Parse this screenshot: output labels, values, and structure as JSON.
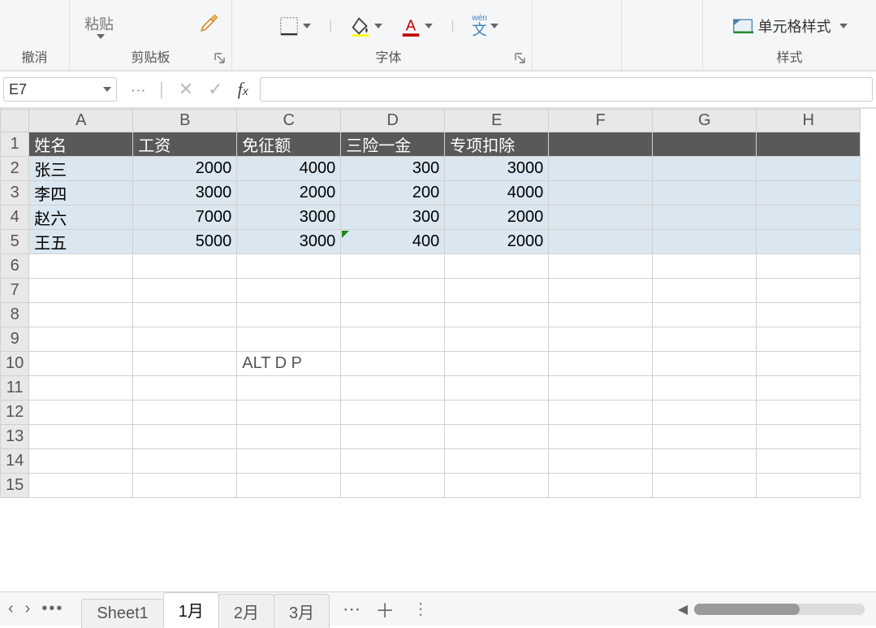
{
  "ribbon": {
    "undo_label": "撤消",
    "paste_partial_label": "粘贴",
    "clipboard_group_label": "剪贴板",
    "font_group_label": "字体",
    "styles_group_label": "样式",
    "cell_styles_label": "单元格样式",
    "wen_small": "wén",
    "wen_char": "文"
  },
  "formula_bar": {
    "active_cell": "E7",
    "fx_value": ""
  },
  "sheet": {
    "columns": [
      "A",
      "B",
      "C",
      "D",
      "E",
      "F",
      "G",
      "H"
    ],
    "row_headers": [
      "1",
      "2",
      "3",
      "4",
      "5",
      "6",
      "7",
      "8",
      "9",
      "10",
      "11",
      "12",
      "13",
      "14",
      "15"
    ],
    "header_row": [
      "姓名",
      "工资",
      "免征额",
      "三险一金",
      "专项扣除"
    ],
    "data_rows": [
      {
        "name": "张三",
        "salary": "2000",
        "exempt": "4000",
        "insurance": "300",
        "deduct": "3000"
      },
      {
        "name": "李四",
        "salary": "3000",
        "exempt": "2000",
        "insurance": "200",
        "deduct": "4000"
      },
      {
        "name": "赵六",
        "salary": "7000",
        "exempt": "3000",
        "insurance": "300",
        "deduct": "2000"
      },
      {
        "name": "王五",
        "salary": "5000",
        "exempt": "3000",
        "insurance": "400",
        "deduct": "2000"
      }
    ],
    "note_text": "ALT D P"
  },
  "tabs": {
    "list": [
      "Sheet1",
      "1月",
      "2月",
      "3月"
    ],
    "active_index": 1
  }
}
